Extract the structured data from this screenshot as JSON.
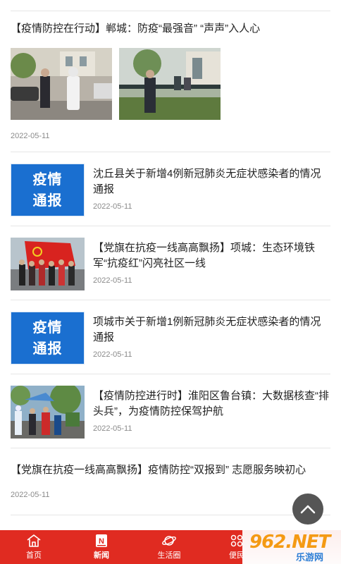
{
  "articles": [
    {
      "title": "【疫情防控在行动】郸城：防疫“最强音” “声声”入人心",
      "date": "2022-05-11"
    },
    {
      "title": "沈丘县关于新增4例新冠肺炎无症状感染者的情况通报",
      "date": "2022-05-11",
      "thumb_lines": [
        "疫情",
        "通报"
      ]
    },
    {
      "title": "【党旗在抗疫一线高高飘扬】项城：生态环境铁军“抗疫红”闪亮社区一线",
      "date": "2022-05-11"
    },
    {
      "title": "项城市关于新增1例新冠肺炎无症状感染者的情况通报",
      "date": "2022-05-11",
      "thumb_lines": [
        "疫情",
        "通报"
      ]
    },
    {
      "title": "【疫情防控进行时】淮阳区鲁台镇：大数据核查“排头兵”，为疫情防控保驾护航",
      "date": "2022-05-11"
    },
    {
      "title": "【党旗在抗疫一线高高飘扬】疫情防控“双报到” 志愿服务映初心",
      "date": "2022-05-11"
    }
  ],
  "tabbar": {
    "items": [
      {
        "label": "首页",
        "icon": "home-icon",
        "active": false
      },
      {
        "label": "新闻",
        "icon": "news-icon",
        "active": true
      },
      {
        "label": "生活圈",
        "icon": "planet-icon",
        "active": false
      },
      {
        "label": "便民",
        "icon": "grid-icon",
        "active": false
      }
    ]
  },
  "watermark": {
    "logo": "962.NET",
    "sub": "乐游网"
  },
  "colors": {
    "tabbar": "#e02b21",
    "notice_blue": "#1a6fd0",
    "backtop": "#555555"
  }
}
